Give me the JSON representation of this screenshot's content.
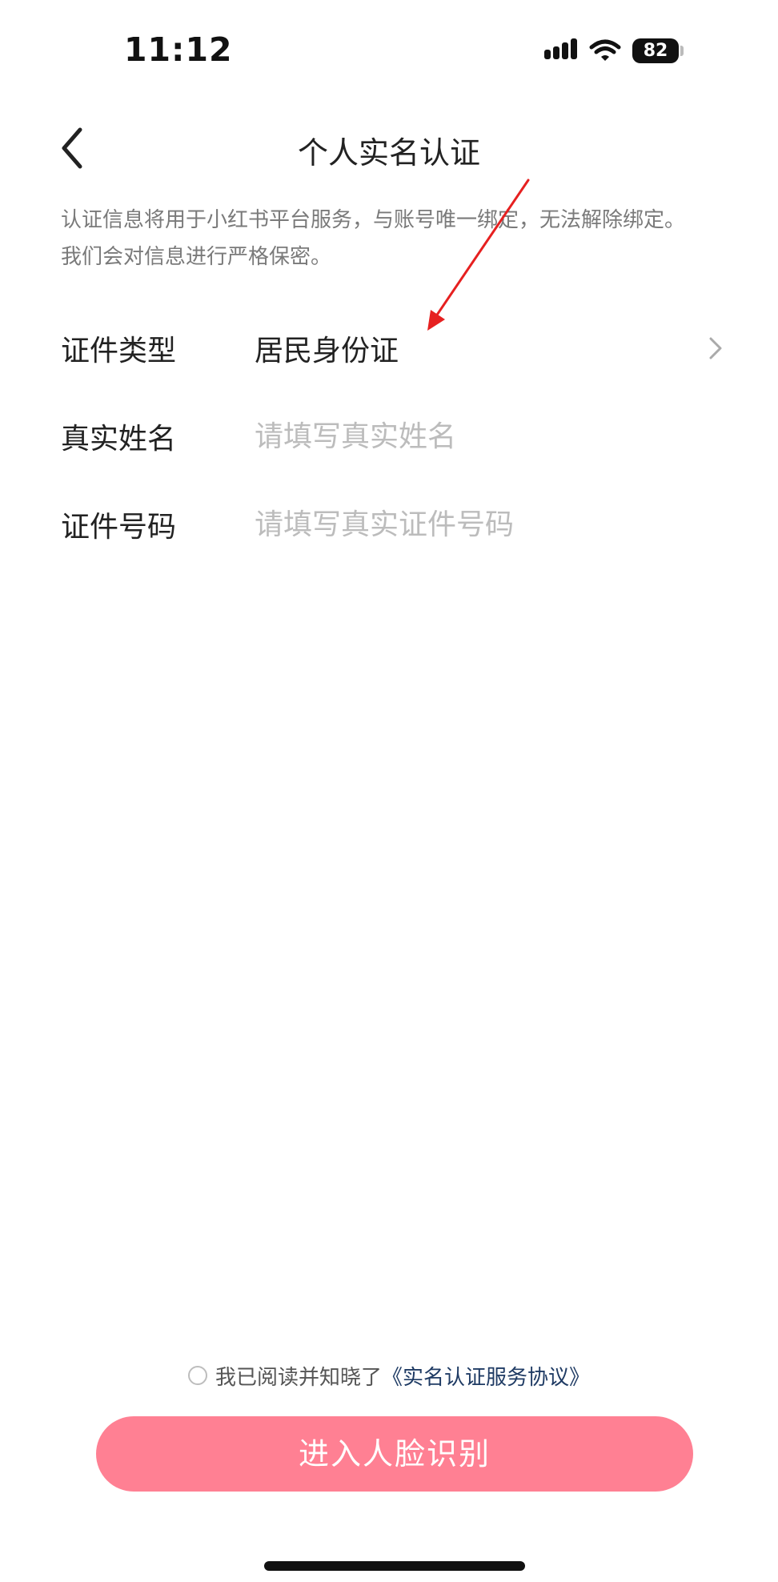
{
  "status_bar": {
    "time": "11:12",
    "battery": "82",
    "icons": [
      "signal-icon",
      "wifi-icon",
      "battery-icon"
    ]
  },
  "header": {
    "back_icon": "chevron-left-icon",
    "title": "个人实名认证"
  },
  "notice": {
    "line1": "认证信息将用于小红书平台服务，与账号唯一绑定，无法解除绑定。",
    "line2": "我们会对信息进行严格保密。"
  },
  "form": {
    "id_type": {
      "label": "证件类型",
      "value": "居民身份证",
      "icon": "chevron-right-icon"
    },
    "real_name": {
      "label": "真实姓名",
      "value": "",
      "placeholder": "请填写真实姓名"
    },
    "id_number": {
      "label": "证件号码",
      "value": "",
      "placeholder": "请填写真实证件号码"
    }
  },
  "agreement": {
    "checked": false,
    "text": "我已阅读并知晓了",
    "link": "《实名认证服务协议》"
  },
  "primary_button": {
    "label": "进入人脸识别"
  },
  "colors": {
    "primary_button_bg": "#ff8093",
    "link": "#1f3b64",
    "placeholder": "#bcbcbc",
    "annotation": "#e62020"
  }
}
